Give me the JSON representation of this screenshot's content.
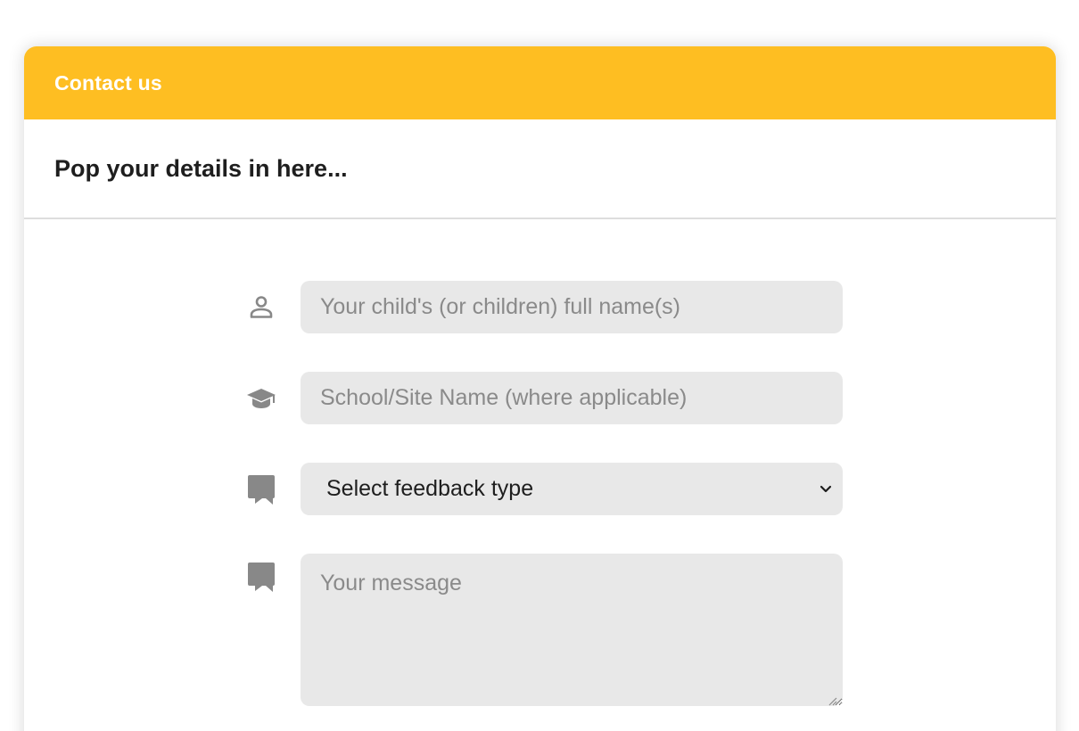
{
  "card": {
    "header_title": "Contact us",
    "subtitle": "Pop your details in here..."
  },
  "form": {
    "child_name": {
      "placeholder": "Your child's (or children) full name(s)",
      "value": "",
      "icon": "user-icon"
    },
    "school_name": {
      "placeholder": "School/Site Name (where applicable)",
      "value": "",
      "icon": "graduation-cap-icon"
    },
    "feedback_type": {
      "selected": "Select feedback type",
      "icon": "comment-icon"
    },
    "message": {
      "placeholder": "Your message",
      "value": "",
      "icon": "comment-icon"
    }
  },
  "colors": {
    "header_bg": "#febe22",
    "field_bg": "#e8e8e8",
    "icon": "#888888",
    "text": "#1e1e1e"
  }
}
